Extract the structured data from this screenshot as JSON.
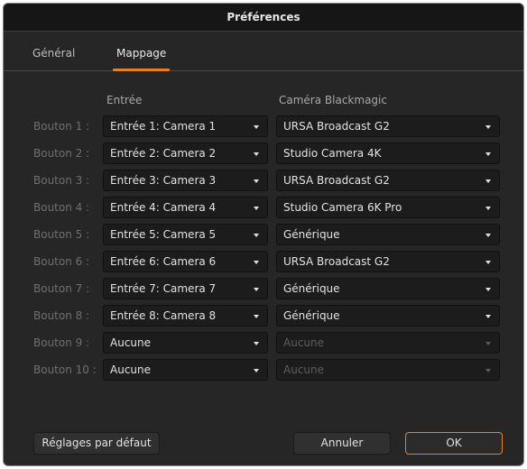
{
  "window": {
    "title": "Préférences"
  },
  "tabs": [
    {
      "label": "Général",
      "active": false
    },
    {
      "label": "Mappage",
      "active": true
    }
  ],
  "columns": {
    "input": "Entrée",
    "camera": "Caméra Blackmagic"
  },
  "rows": [
    {
      "label": "Bouton 1 :",
      "input": "Entrée 1: Camera 1",
      "camera": "URSA Broadcast G2",
      "camera_enabled": true
    },
    {
      "label": "Bouton 2 :",
      "input": "Entrée 2: Camera 2",
      "camera": "Studio Camera 4K",
      "camera_enabled": true
    },
    {
      "label": "Bouton 3 :",
      "input": "Entrée 3: Camera 3",
      "camera": "URSA Broadcast G2",
      "camera_enabled": true
    },
    {
      "label": "Bouton 4 :",
      "input": "Entrée 4: Camera 4",
      "camera": "Studio Camera 6K Pro",
      "camera_enabled": true
    },
    {
      "label": "Bouton 5 :",
      "input": "Entrée 5: Camera 5",
      "camera": "Générique",
      "camera_enabled": true
    },
    {
      "label": "Bouton 6 :",
      "input": "Entrée 6: Camera 6",
      "camera": "URSA Broadcast G2",
      "camera_enabled": true
    },
    {
      "label": "Bouton 7 :",
      "input": "Entrée 7: Camera 7",
      "camera": "Générique",
      "camera_enabled": true
    },
    {
      "label": "Bouton 8 :",
      "input": "Entrée 8: Camera 8",
      "camera": "Générique",
      "camera_enabled": true
    },
    {
      "label": "Bouton 9 :",
      "input": "Aucune",
      "camera": "Aucune",
      "camera_enabled": false
    },
    {
      "label": "Bouton 10 :",
      "input": "Aucune",
      "camera": "Aucune",
      "camera_enabled": false
    }
  ],
  "buttons": {
    "defaults": "Réglages par défaut",
    "cancel": "Annuler",
    "ok": "OK"
  },
  "colors": {
    "accent": "#e8801f",
    "background": "#262626",
    "titlebar": "#161616"
  },
  "icons": {
    "dropdown": "chevron-down-icon"
  }
}
